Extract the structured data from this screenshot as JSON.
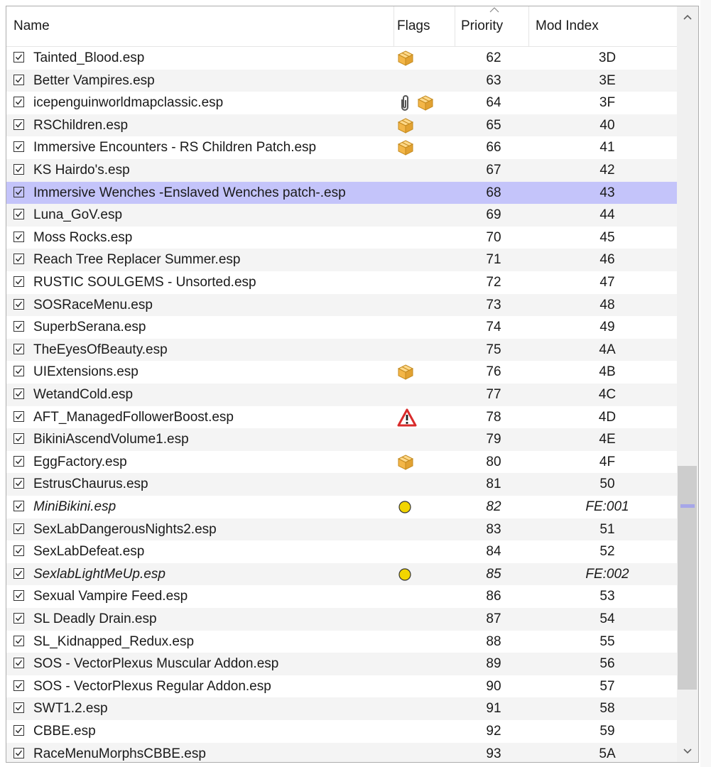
{
  "columns": {
    "name": "Name",
    "flags": "Flags",
    "priority": "Priority",
    "mod_index": "Mod Index"
  },
  "sort": {
    "column": "Priority",
    "direction": "ascending"
  },
  "rows": [
    {
      "name": "Tainted_Blood.esp",
      "flags": [
        "package"
      ],
      "priority": "62",
      "index": "3D",
      "checked": true
    },
    {
      "name": "Better Vampires.esp",
      "flags": [],
      "priority": "63",
      "index": "3E",
      "checked": true
    },
    {
      "name": "icepenguinworldmapclassic.esp",
      "flags": [
        "attachment",
        "package"
      ],
      "priority": "64",
      "index": "3F",
      "checked": true
    },
    {
      "name": "RSChildren.esp",
      "flags": [
        "package"
      ],
      "priority": "65",
      "index": "40",
      "checked": true
    },
    {
      "name": "Immersive Encounters - RS Children Patch.esp",
      "flags": [
        "package"
      ],
      "priority": "66",
      "index": "41",
      "checked": true
    },
    {
      "name": "KS Hairdo's.esp",
      "flags": [],
      "priority": "67",
      "index": "42",
      "checked": true
    },
    {
      "name": "Immersive Wenches -Enslaved Wenches patch-.esp",
      "flags": [],
      "priority": "68",
      "index": "43",
      "checked": true,
      "selected": true
    },
    {
      "name": "Luna_GoV.esp",
      "flags": [],
      "priority": "69",
      "index": "44",
      "checked": true
    },
    {
      "name": "Moss Rocks.esp",
      "flags": [],
      "priority": "70",
      "index": "45",
      "checked": true
    },
    {
      "name": "Reach Tree Replacer Summer.esp",
      "flags": [],
      "priority": "71",
      "index": "46",
      "checked": true
    },
    {
      "name": "RUSTIC SOULGEMS - Unsorted.esp",
      "flags": [],
      "priority": "72",
      "index": "47",
      "checked": true
    },
    {
      "name": "SOSRaceMenu.esp",
      "flags": [],
      "priority": "73",
      "index": "48",
      "checked": true
    },
    {
      "name": "SuperbSerana.esp",
      "flags": [],
      "priority": "74",
      "index": "49",
      "checked": true
    },
    {
      "name": "TheEyesOfBeauty.esp",
      "flags": [],
      "priority": "75",
      "index": "4A",
      "checked": true
    },
    {
      "name": "UIExtensions.esp",
      "flags": [
        "package"
      ],
      "priority": "76",
      "index": "4B",
      "checked": true
    },
    {
      "name": "WetandCold.esp",
      "flags": [],
      "priority": "77",
      "index": "4C",
      "checked": true
    },
    {
      "name": "AFT_ManagedFollowerBoost.esp",
      "flags": [
        "warning"
      ],
      "priority": "78",
      "index": "4D",
      "checked": true
    },
    {
      "name": "BikiniAscendVolume1.esp",
      "flags": [],
      "priority": "79",
      "index": "4E",
      "checked": true
    },
    {
      "name": "EggFactory.esp",
      "flags": [
        "package"
      ],
      "priority": "80",
      "index": "4F",
      "checked": true
    },
    {
      "name": "EstrusChaurus.esp",
      "flags": [],
      "priority": "81",
      "index": "50",
      "checked": true
    },
    {
      "name": "MiniBikini.esp",
      "flags": [
        "light"
      ],
      "priority": "82",
      "index": "FE:001",
      "checked": true,
      "italic": true
    },
    {
      "name": "SexLabDangerousNights2.esp",
      "flags": [],
      "priority": "83",
      "index": "51",
      "checked": true
    },
    {
      "name": "SexLabDefeat.esp",
      "flags": [],
      "priority": "84",
      "index": "52",
      "checked": true
    },
    {
      "name": "SexlabLightMeUp.esp",
      "flags": [
        "light"
      ],
      "priority": "85",
      "index": "FE:002",
      "checked": true,
      "italic": true
    },
    {
      "name": "Sexual Vampire Feed.esp",
      "flags": [],
      "priority": "86",
      "index": "53",
      "checked": true
    },
    {
      "name": "SL Deadly Drain.esp",
      "flags": [],
      "priority": "87",
      "index": "54",
      "checked": true
    },
    {
      "name": "SL_Kidnapped_Redux.esp",
      "flags": [],
      "priority": "88",
      "index": "55",
      "checked": true
    },
    {
      "name": "SOS - VectorPlexus Muscular Addon.esp",
      "flags": [],
      "priority": "89",
      "index": "56",
      "checked": true
    },
    {
      "name": "SOS - VectorPlexus Regular Addon.esp",
      "flags": [],
      "priority": "90",
      "index": "57",
      "checked": true
    },
    {
      "name": "SWT1.2.esp",
      "flags": [],
      "priority": "91",
      "index": "58",
      "checked": true
    },
    {
      "name": "CBBE.esp",
      "flags": [],
      "priority": "92",
      "index": "59",
      "checked": true
    },
    {
      "name": "RaceMenuMorphsCBBE.esp",
      "flags": [],
      "priority": "93",
      "index": "5A",
      "checked": true
    }
  ],
  "icons": {
    "package": "package-icon",
    "attachment": "paperclip-icon",
    "warning": "warning-icon",
    "light": "light-plugin-icon"
  },
  "colors": {
    "selected_row": "#c4c4fa",
    "alt_row": "#f4f4f4",
    "light_plugin": "#f2d500",
    "warning": "#d92b2b",
    "package": "#f0b43c"
  }
}
